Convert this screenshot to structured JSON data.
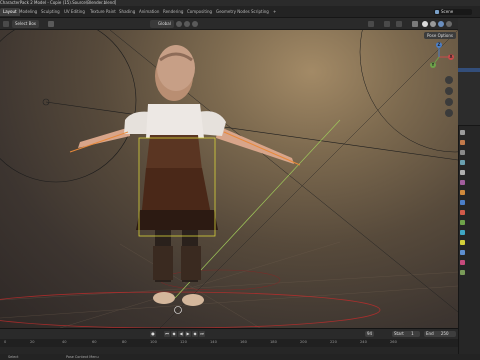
{
  "window": {
    "title": "CharacterPack 2 Model - Copie (15).Source\\Blender.blend]"
  },
  "workspace_tabs": [
    {
      "label": "Layout",
      "active": true
    },
    {
      "label": "Modeling",
      "active": false
    },
    {
      "label": "Sculpting",
      "active": false
    },
    {
      "label": "UV Editing",
      "active": false
    },
    {
      "label": "Texture Paint",
      "active": false
    },
    {
      "label": "Shading",
      "active": false
    },
    {
      "label": "Animation",
      "active": false
    },
    {
      "label": "Rendering",
      "active": false
    },
    {
      "label": "Compositing",
      "active": false
    },
    {
      "label": "Geometry Nodes",
      "active": false
    },
    {
      "label": "Scripting",
      "active": false
    },
    {
      "label": "+",
      "active": false
    }
  ],
  "scene": {
    "name": "Scene"
  },
  "header": {
    "select_box": "Select Box",
    "transform": "Global"
  },
  "viewport": {
    "pose_options": "Pose Options",
    "gizmo": {
      "x": "X",
      "y": "Y",
      "z": "Z"
    }
  },
  "timeline": {
    "current_frame": "94",
    "start_label": "Start",
    "start_value": "1",
    "end_label": "End",
    "end_value": "250",
    "ruler": [
      "0",
      "20",
      "40",
      "60",
      "80",
      "100",
      "120",
      "140",
      "160",
      "180",
      "200",
      "220",
      "240",
      "260"
    ]
  },
  "status_bar": {
    "left": "Select",
    "middle": "Pose Context Menu"
  },
  "colors": {
    "accent": "#4b7fc9",
    "bone_orange": "#e8893a",
    "bone_yellow": "#d8d23a",
    "pose_green": "#9fc95a"
  }
}
